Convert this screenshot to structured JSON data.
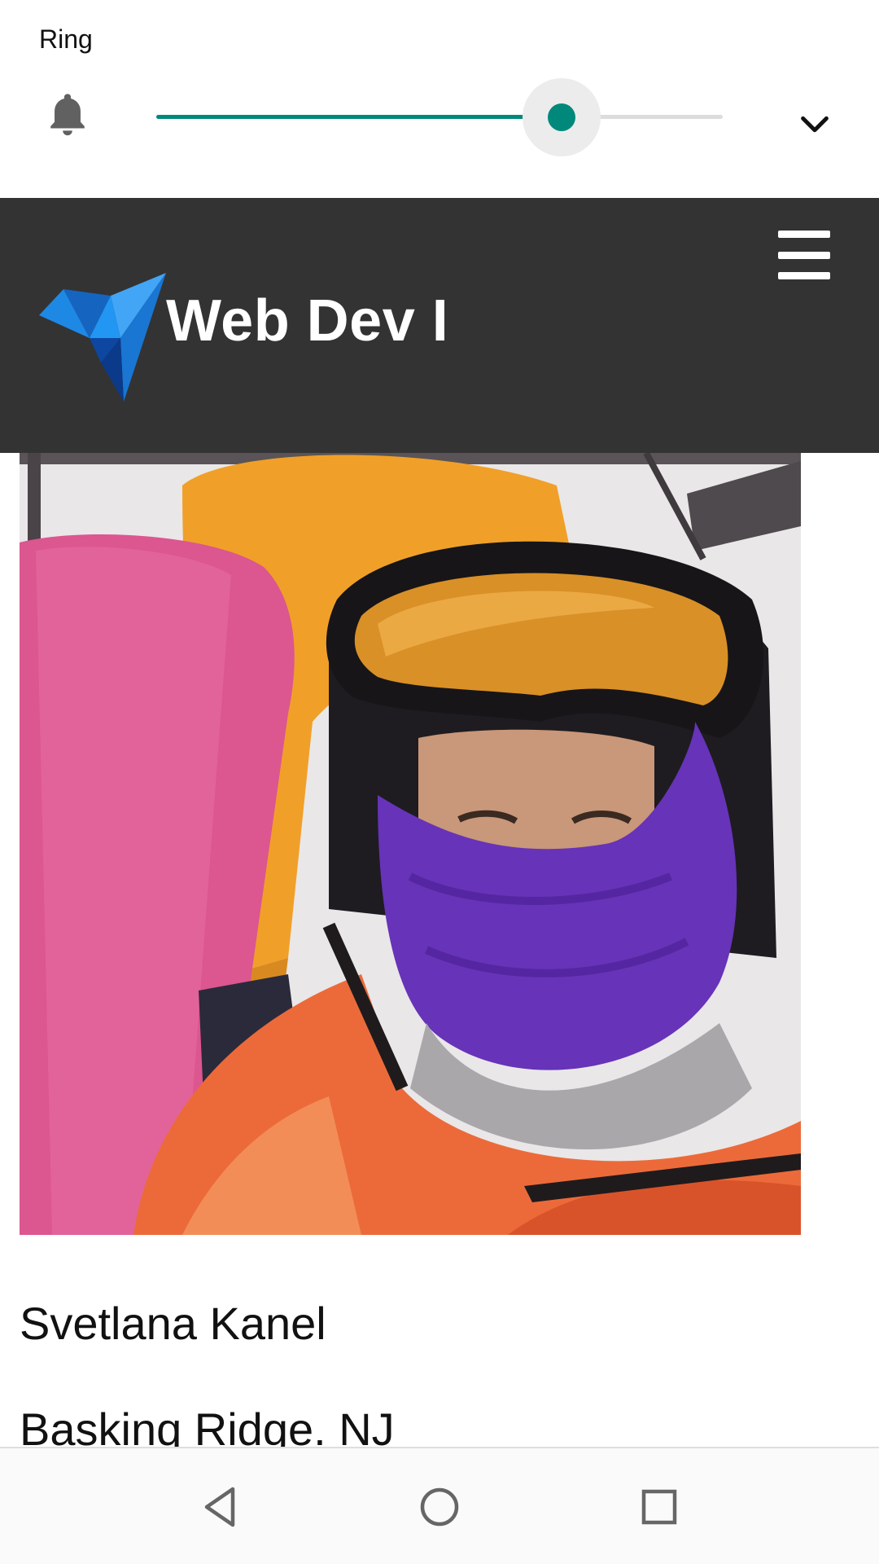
{
  "volume_panel": {
    "stream_label": "Ring",
    "level": 0.715,
    "accent_color": "#00897b",
    "icons": {
      "stream": "bell-icon",
      "expand": "chevron-down-icon"
    }
  },
  "header": {
    "title": "Web Dev I",
    "background_color": "#333333",
    "icons": {
      "logo": "bird-logo-icon",
      "menu": "hamburger-menu-icon"
    }
  },
  "profile": {
    "photo_description": "photo",
    "name": "Svetlana Kanel",
    "location": "Baskinq Ridge. NJ"
  },
  "nav_bar": {
    "icons": [
      "back-triangle-icon",
      "home-circle-icon",
      "recents-square-icon"
    ]
  }
}
